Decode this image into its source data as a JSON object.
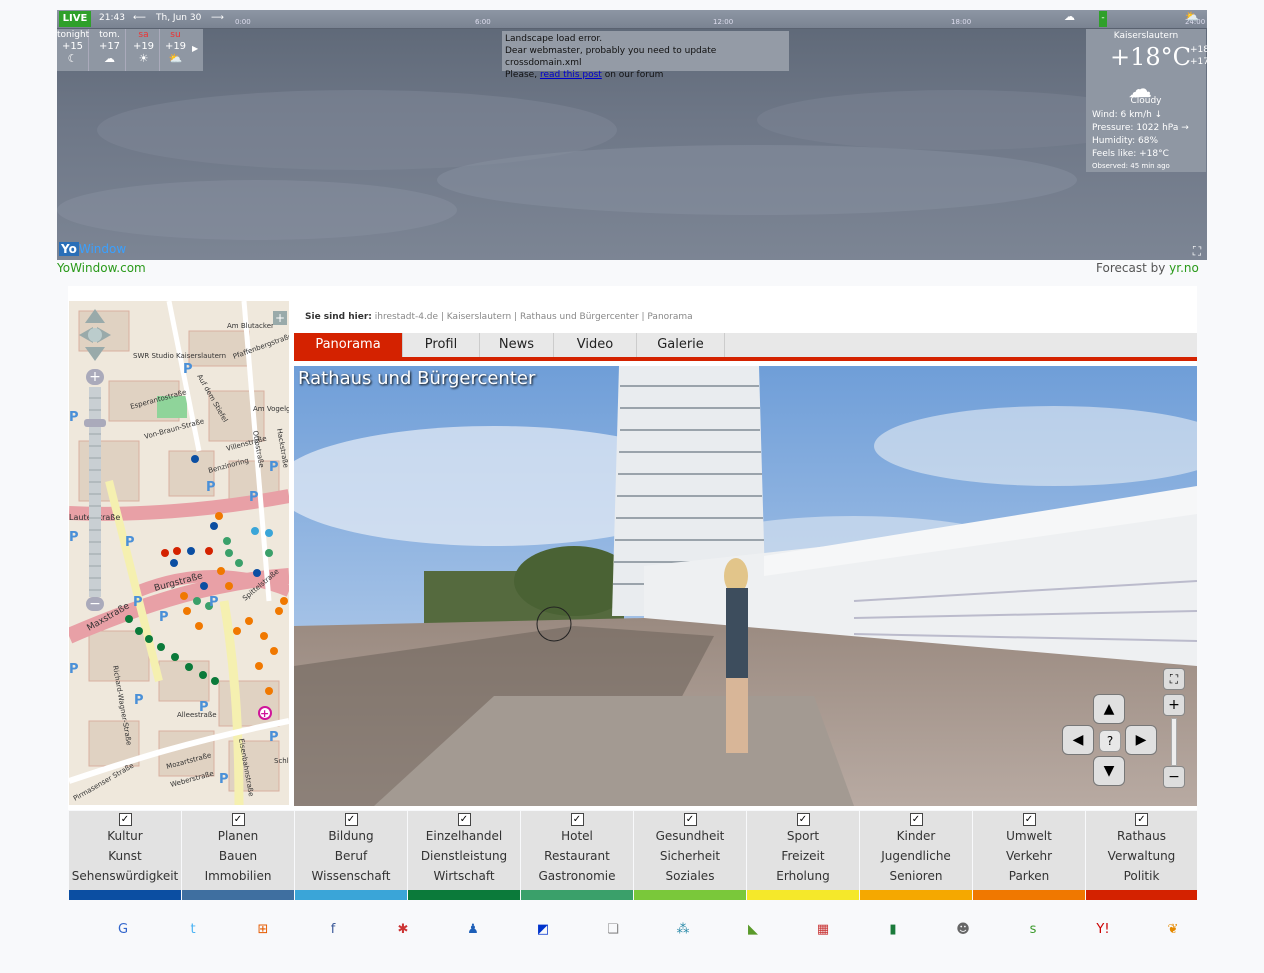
{
  "weather": {
    "live_label": "LIVE",
    "time": "21:43",
    "date": "Th, Jun 30",
    "ticks": [
      "0:00",
      "6:00",
      "12:00",
      "18:00",
      "24:00"
    ],
    "forecast": [
      {
        "day": "tonight",
        "temp": "+15",
        "icon": "moon-cloud-icon",
        "alert": false
      },
      {
        "day": "tom.",
        "temp": "+17",
        "icon": "rain-cloud-icon",
        "alert": false
      },
      {
        "day": "sa",
        "temp": "+19",
        "icon": "sun-icon",
        "alert": true
      },
      {
        "day": "su",
        "temp": "+19",
        "icon": "sun-cloud-icon",
        "alert": true
      }
    ],
    "error": {
      "line1": "Landscape load error.",
      "line2": "Dear webmaster, probably you need to update crossdomain.xml",
      "line3_pre": "Please,",
      "link": "read this post",
      "line3_post": "on our forum"
    },
    "current": {
      "city": "Kaiserslautern",
      "temp": "+18°C",
      "high": "+18",
      "low": "+17",
      "condition": "Cloudy",
      "wind": "Wind:  6 km/h ↓",
      "pressure": "Pressure:  1022 hPa →",
      "humidity": "Humidity:  68%",
      "feels": "Feels like:  +18°C",
      "observed": "Observed:  45 min ago"
    },
    "logo_yo": "Yo",
    "logo_window": "Window",
    "link": "YoWindow.com",
    "credit_pre": "Forecast by",
    "credit_src": "yr.no"
  },
  "breadcrumb": {
    "label": "Sie sind hier:",
    "path": "ihrestadt-4.de | Kaiserslautern | Rathaus und Bürgercenter | Panorama"
  },
  "tabs": [
    "Panorama",
    "Profil",
    "News",
    "Video",
    "Galerie"
  ],
  "panorama": {
    "title": "Rathaus und Bürgercenter"
  },
  "map": {
    "streets": [
      "Am Blutacker",
      "SWR Studio Kaiserslautern",
      "Pfaffenbergstraße",
      "Auf dem Stiefel",
      "Esperantostraße",
      "Am Vogelgesang",
      "Von-Braun-Straße",
      "Villenstraße",
      "Benzinoring",
      "Ottostraße",
      "Hackstraße",
      "Lauterstraße",
      "Burgstraße",
      "Spittelstraße",
      "Maxstraße",
      "Richard-Wagner-Straße",
      "Alleestraße",
      "Eisenbahnstraße",
      "Pirmasenser Straße",
      "Mozartstraße",
      "Weberstraße",
      "Schl"
    ]
  },
  "categories": [
    {
      "lines": [
        "Kultur",
        "Kunst",
        "Sehenswürdigkeit"
      ],
      "color": "#0b4ea2"
    },
    {
      "lines": [
        "Planen",
        "Bauen",
        "Immobilien"
      ],
      "color": "#3f6fa0"
    },
    {
      "lines": [
        "Bildung",
        "Beruf",
        "Wissenschaft"
      ],
      "color": "#3aa5d8"
    },
    {
      "lines": [
        "Einzelhandel",
        "Dienstleistung",
        "Wirtschaft"
      ],
      "color": "#0b7a3a"
    },
    {
      "lines": [
        "Hotel",
        "Restaurant",
        "Gastronomie"
      ],
      "color": "#3aa06a"
    },
    {
      "lines": [
        "Gesundheit",
        "Sicherheit",
        "Soziales"
      ],
      "color": "#7ac83a"
    },
    {
      "lines": [
        "Sport",
        "Freizeit",
        "Erholung"
      ],
      "color": "#f5e82a"
    },
    {
      "lines": [
        "Kinder",
        "Jugendliche",
        "Senioren"
      ],
      "color": "#f5a800"
    },
    {
      "lines": [
        "Umwelt",
        "Verkehr",
        "Parken"
      ],
      "color": "#f07800"
    },
    {
      "lines": [
        "Rathaus",
        "Verwaltung",
        "Politik"
      ],
      "color": "#d42200"
    }
  ],
  "checkbox_mark": "✓",
  "social": [
    {
      "name": "google-icon",
      "glyph": "G",
      "color": "#3366cc"
    },
    {
      "name": "twitter-icon",
      "glyph": "t",
      "color": "#4ab3f4"
    },
    {
      "name": "windows-live-icon",
      "glyph": "⊞",
      "color": "#e65c00"
    },
    {
      "name": "facebook-icon",
      "glyph": "f",
      "color": "#3b5998"
    },
    {
      "name": "yigg-icon",
      "glyph": "✱",
      "color": "#cc3333"
    },
    {
      "name": "myspace-icon",
      "glyph": "♟",
      "color": "#1d5fb8"
    },
    {
      "name": "delicious-icon",
      "glyph": "◩",
      "color": "#0033cc"
    },
    {
      "name": "mister-wong-icon",
      "glyph": "❏",
      "color": "#888888"
    },
    {
      "name": "misterwong-dots-icon",
      "glyph": "⁂",
      "color": "#2a8aa8"
    },
    {
      "name": "linkarena-icon",
      "glyph": "◣",
      "color": "#5a9a2a"
    },
    {
      "name": "webnews-icon",
      "glyph": "▦",
      "color": "#c83232"
    },
    {
      "name": "oneview-icon",
      "glyph": "▮",
      "color": "#1a7a3a"
    },
    {
      "name": "reddit-icon",
      "glyph": "☻",
      "color": "#666666"
    },
    {
      "name": "stumbleupon-icon",
      "glyph": "s",
      "color": "#3a9a2a"
    },
    {
      "name": "yahoo-icon",
      "glyph": "Y!",
      "color": "#cc0000"
    },
    {
      "name": "favorites-icon",
      "glyph": "❦",
      "color": "#e68a00"
    }
  ]
}
